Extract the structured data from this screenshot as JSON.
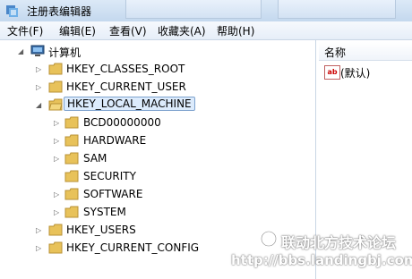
{
  "window": {
    "title": "注册表编辑器"
  },
  "menu": [
    "文件(F)",
    "编辑(E)",
    "查看(V)",
    "收藏夹(A)",
    "帮助(H)"
  ],
  "tree": {
    "root": "计算机",
    "hives": [
      "HKEY_CLASSES_ROOT",
      "HKEY_CURRENT_USER",
      "HKEY_LOCAL_MACHINE",
      "HKEY_USERS",
      "HKEY_CURRENT_CONFIG"
    ],
    "selected": "HKEY_LOCAL_MACHINE",
    "hklm_children": [
      "BCD00000000",
      "HARDWARE",
      "SAM",
      "SECURITY",
      "SOFTWARE",
      "SYSTEM"
    ]
  },
  "values_pane": {
    "column_name": "名称",
    "rows": [
      "(默认)"
    ]
  },
  "watermark": {
    "line1": "联动北方技术论坛",
    "line2": "http://bbs.landingbj.com"
  },
  "colors": {
    "selection_bg": "#dcebfc",
    "selection_border": "#7da2ce",
    "folder": "#e8c25a"
  }
}
